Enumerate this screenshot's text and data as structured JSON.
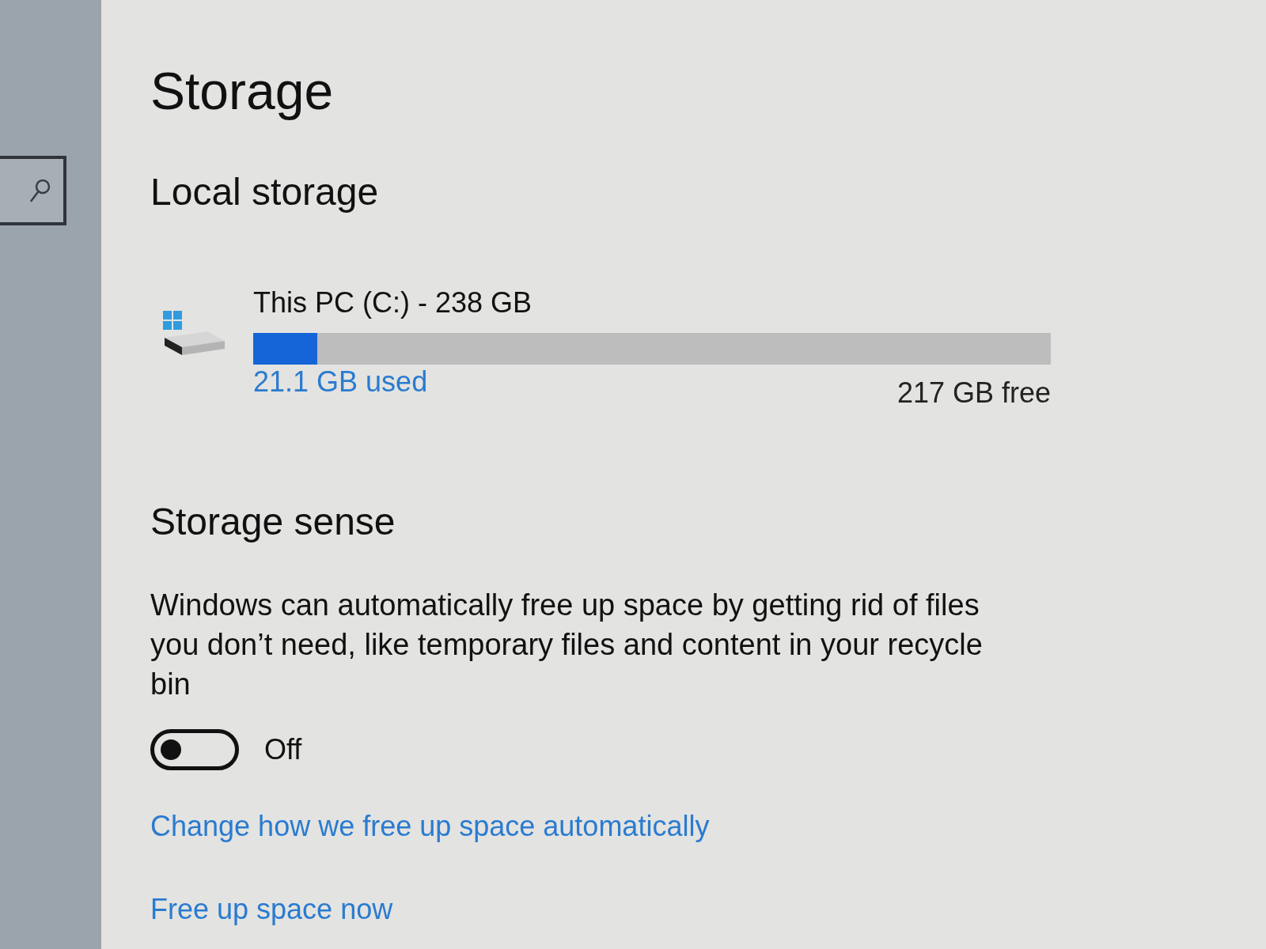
{
  "page": {
    "title": "Storage"
  },
  "local_storage": {
    "heading": "Local storage",
    "drives": [
      {
        "name": "This PC (C:) - 238 GB",
        "level": 0.08,
        "used": "21.1 GB used",
        "free": "217 GB free"
      }
    ]
  },
  "storage_sense": {
    "heading": "Storage sense",
    "description": "Windows can automatically free up space by getting rid of files you don’t need, like temporary files and content in your recycle bin",
    "toggle": {
      "on": false,
      "label": "Off"
    },
    "links": [
      "Change how we free up space automatically",
      "Free up space now"
    ]
  }
}
